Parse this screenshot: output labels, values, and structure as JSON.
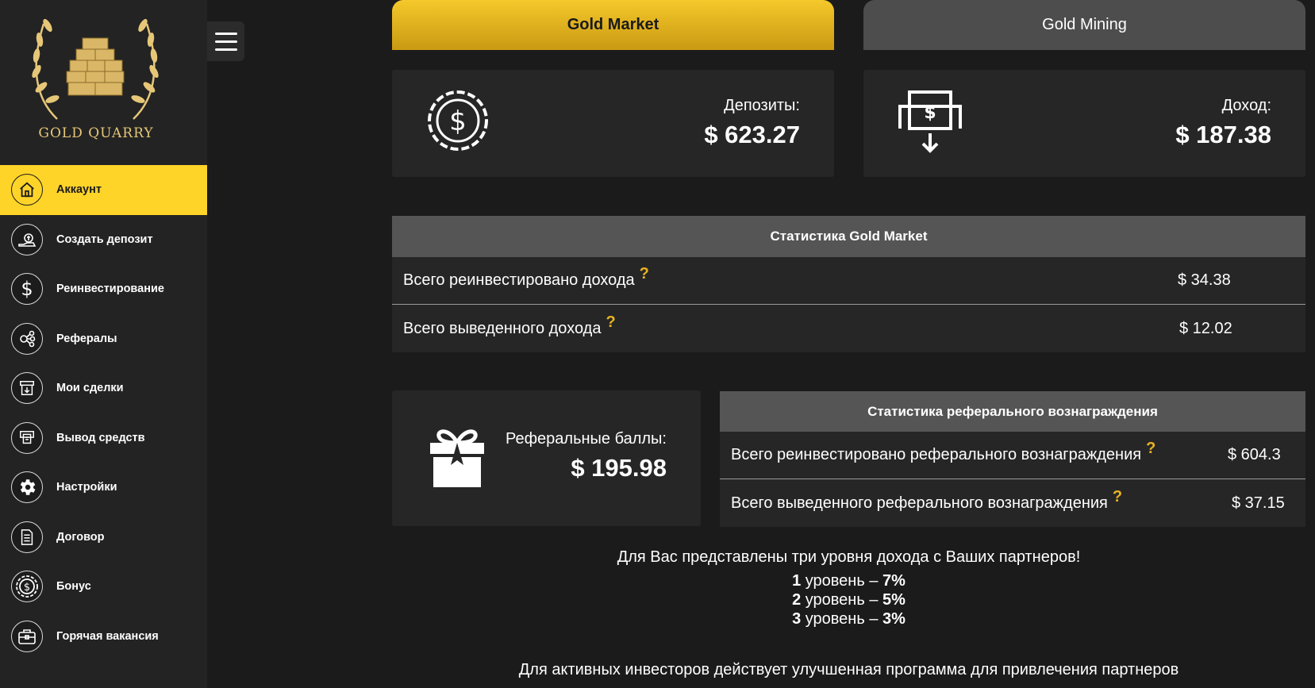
{
  "brand": {
    "name": "GOLD QUARRY"
  },
  "sidebar": {
    "items": [
      {
        "label": "Аккаунт",
        "icon": "home-icon",
        "active": true
      },
      {
        "label": "Создать депозит",
        "icon": "money-hand-icon"
      },
      {
        "label": "Реинвестирование",
        "icon": "dollar-icon"
      },
      {
        "label": "Рефералы",
        "icon": "share-icon"
      },
      {
        "label": "Мои сделки",
        "icon": "download-box-icon"
      },
      {
        "label": "Вывод средств",
        "icon": "withdraw-icon"
      },
      {
        "label": "Настройки",
        "icon": "gear-icon"
      },
      {
        "label": "Договор",
        "icon": "document-icon"
      },
      {
        "label": "Бонус",
        "icon": "coin-icon"
      },
      {
        "label": "Горячая вакансия",
        "icon": "briefcase-icon"
      }
    ]
  },
  "tabs": {
    "market": "Gold Market",
    "mining": "Gold Mining"
  },
  "cards": {
    "deposits": {
      "label": "Депозиты:",
      "value": "$ 623.27"
    },
    "income": {
      "label": "Доход:",
      "value": "$ 187.38"
    }
  },
  "market_stats": {
    "title": "Статистика Gold Market",
    "rows": [
      {
        "label": "Всего реинвестировано дохода",
        "value": "$ 34.38"
      },
      {
        "label": "Всего выведенного дохода",
        "value": "$ 12.02"
      }
    ]
  },
  "referral": {
    "label": "Реферальные баллы:",
    "value": "$ 195.98"
  },
  "referral_stats": {
    "title": "Статистика реферального вознаграждения",
    "rows": [
      {
        "label": "Всего реинвестировано реферального вознаграждения",
        "value": "$ 604.3"
      },
      {
        "label": "Всего выведенного реферального вознаграждения",
        "value": "$ 37.15"
      }
    ]
  },
  "help_mark": "?",
  "levels": {
    "intro": "Для Вас представлены три уровня дохода с Ваших партнеров!",
    "items": [
      {
        "num": "1",
        "text": "уровень –",
        "pct": "7%"
      },
      {
        "num": "2",
        "text": "уровень –",
        "pct": "5%"
      },
      {
        "num": "3",
        "text": "уровень –",
        "pct": "3%"
      }
    ]
  },
  "bottom_text": "Для активных инвесторов действует улучшенная программа для привлечения партнеров",
  "colors": {
    "accent": "#ffd429",
    "gold_text": "#e6c778",
    "panel": "#262626",
    "header": "#555555"
  }
}
